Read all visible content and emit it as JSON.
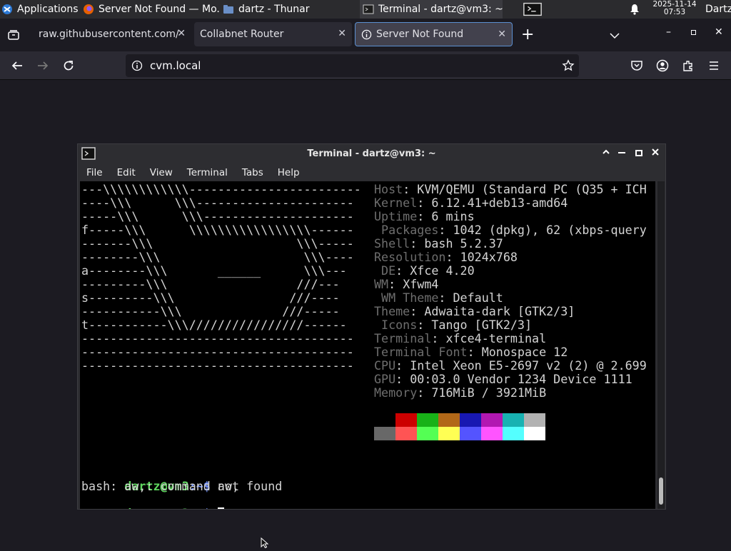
{
  "panel": {
    "applications": "Applications",
    "tasks": [
      {
        "label": "Server Not Found — Mo..."
      },
      {
        "label": "dartz - Thunar"
      },
      {
        "label": "Terminal - dartz@vm3: ~"
      }
    ],
    "date": "2025-11-14",
    "time": "07:53",
    "user": "Dartz"
  },
  "browser": {
    "tabs": [
      {
        "title": "raw.githubusercontent.com/"
      },
      {
        "title": "Collabnet Router"
      },
      {
        "title": "Server Not Found"
      }
    ],
    "url": "cvm.local"
  },
  "terminal": {
    "title": "Terminal - dartz@vm3: ~",
    "menu": [
      "File",
      "Edit",
      "View",
      "Terminal",
      "Tabs",
      "Help"
    ],
    "logo": [
      "---\\\\\\\\\\\\\\\\\\\\\\\\------------------------",
      "----\\\\\\      \\\\\\----------------------",
      "-----\\\\\\      \\\\\\---------------------",
      "f-----\\\\\\      \\\\\\\\\\\\\\\\\\\\\\\\\\\\\\\\\\------",
      "-------\\\\\\                    \\\\\\-----",
      "--------\\\\\\                    \\\\\\----",
      "a--------\\\\\\       ______      \\\\\\---",
      "---------\\\\\\                  ///---",
      "s---------\\\\\\                ///----",
      "-----------\\\\\\              ///-----",
      "t-----------\\\\\\////////////////------",
      "--------------------------------------",
      "--------------------------------------",
      "--------------------------------------"
    ],
    "info": [
      {
        "key": "Host",
        "value": "KVM/QEMU (Standard PC (Q35 + ICH"
      },
      {
        "key": "Kernel",
        "value": "6.12.41+deb13-amd64"
      },
      {
        "key": "Uptime",
        "value": "6 mins"
      },
      {
        "key": " Packages",
        "value": "1042 (dpkg), 62 (xbps-query"
      },
      {
        "key": "Shell",
        "value": "bash 5.2.37"
      },
      {
        "key": "Resolution",
        "value": "1024x768"
      },
      {
        "key": " DE",
        "value": "Xfce 4.20"
      },
      {
        "key": "WM",
        "value": "Xfwm4"
      },
      {
        "key": " WM Theme",
        "value": "Default"
      },
      {
        "key": "Theme",
        "value": "Adwaita-dark [GTK2/3]"
      },
      {
        "key": " Icons",
        "value": "Tango [GTK2/3]"
      },
      {
        "key": "Terminal",
        "value": "xfce4-terminal"
      },
      {
        "key": "Terminal Font",
        "value": "Monospace 12"
      },
      {
        "key": "CPU",
        "value": "Intel Xeon E5-2697 v2 (2) @ 2.699"
      },
      {
        "key": "GPU",
        "value": "00:03.0 Vendor 1234 Device 1111"
      },
      {
        "key": "Memory",
        "value": "716MiB / 3921MiB"
      }
    ],
    "palette_top": [
      "#000000",
      "#cc0000",
      "#18b218",
      "#b26818",
      "#1818b2",
      "#b218b2",
      "#18b2b2",
      "#b2b2b2"
    ],
    "palette_bottom": [
      "#686868",
      "#ff5454",
      "#54ff54",
      "#ffff54",
      "#5454ff",
      "#ff54ff",
      "#54ffff",
      "#ffffff"
    ],
    "prompt_user": "dartz@vm3",
    "prompt_path": ":~$",
    "cmd1": " aw,",
    "error": "bash: aw,: command not found",
    "cmd2": " "
  }
}
